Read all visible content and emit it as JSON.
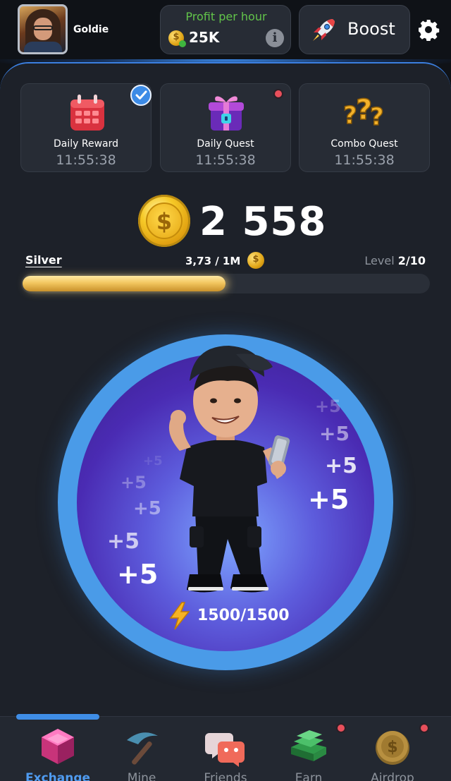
{
  "header": {
    "username": "Goldie",
    "profit_label": "Profit per hour",
    "profit_value": "25K",
    "boost_label": "Boost"
  },
  "quests": [
    {
      "title": "Daily Reward",
      "timer": "11:55:38",
      "icon": "calendar-icon",
      "completed": true
    },
    {
      "title": "Daily Quest",
      "timer": "11:55:38",
      "icon": "gift-icon",
      "notification": true
    },
    {
      "title": "Combo Quest",
      "timer": "11:55:38",
      "icon": "question-marks-icon"
    }
  ],
  "balance": {
    "value": "2 558"
  },
  "league": {
    "name": "Silver",
    "progress_text": "3,73 / 1M",
    "level_label": "Level",
    "level_value": "2/10",
    "progress_fraction": 0.5
  },
  "tap": {
    "floating_text": "+5",
    "energy": "1500/1500"
  },
  "nav": {
    "items": [
      {
        "label": "Exchange",
        "icon": "exchange-cube-icon",
        "active": true
      },
      {
        "label": "Mine",
        "icon": "pickaxe-icon"
      },
      {
        "label": "Friends",
        "icon": "friends-icon"
      },
      {
        "label": "Earn",
        "icon": "earn-coins-icon",
        "notification": true
      },
      {
        "label": "Airdrop",
        "icon": "airdrop-coin-icon",
        "notification": true
      }
    ]
  },
  "colors": {
    "accent": "#3f8de6",
    "profit_green": "#62c44a",
    "notification_red": "#e84f5b",
    "coin_gold": "#f6c927"
  }
}
